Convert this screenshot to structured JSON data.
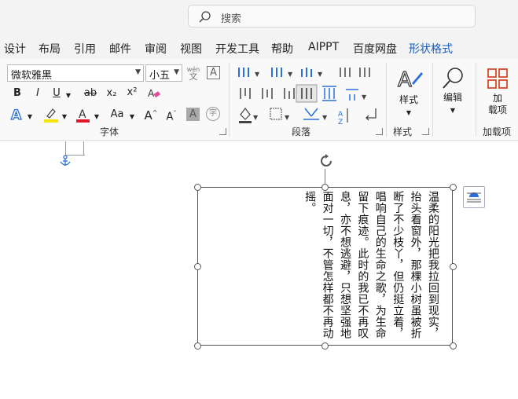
{
  "search": {
    "placeholder": "搜索"
  },
  "menu": [
    "设计",
    "布局",
    "引用",
    "邮件",
    "审阅",
    "视图",
    "开发工具",
    "帮助",
    "AIPPT",
    "百度网盘",
    "形状格式"
  ],
  "font": {
    "name": "微软雅黑",
    "size": "小五",
    "wen_top": "wén",
    "wen_bottom": "文",
    "char_border": "A",
    "bold": "B",
    "italic": "I",
    "underline": "U",
    "strike": "ab",
    "subscript": "x₂",
    "superscript": "x²",
    "aa": "Aa",
    "grow": "A",
    "shrink": "A",
    "shade": "A",
    "enclose": "字",
    "group_label": "字体"
  },
  "paragraph": {
    "group_label": "段落"
  },
  "styles": {
    "button_label": "样式",
    "group_label": "样式"
  },
  "editing": {
    "button_label": "编辑"
  },
  "addins": {
    "button_label": "加\n载项",
    "group_label": "加载项"
  },
  "document": {
    "text": "温柔的阳光把我拉回到现实，抬头看窗外，那棵小树虽被折断了不少枝丫，但仍挺立着，唱响自己的生命之歌，为生命留下痕迹。此时的我已不再叹息，亦不想逃避，只想坚强地面对一切，不管怎样都不再动摇。"
  }
}
